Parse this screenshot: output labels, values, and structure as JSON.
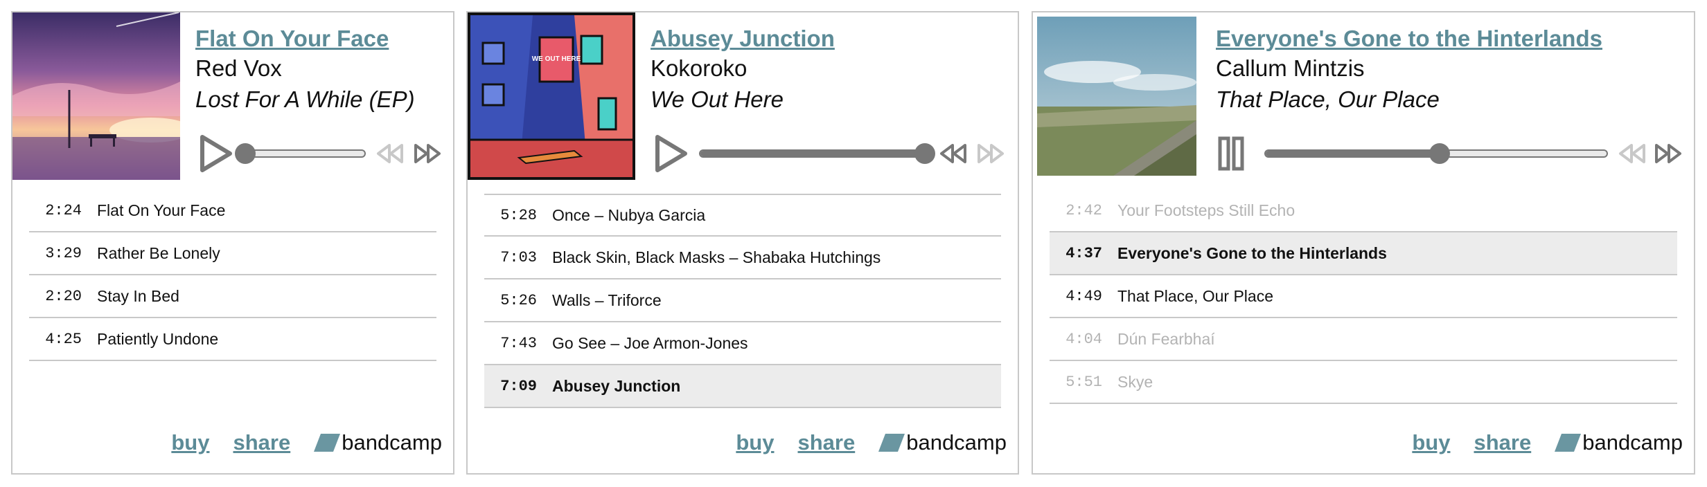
{
  "players": [
    {
      "title": "Flat On Your Face",
      "artist": "Red Vox",
      "album": "Lost For A While (EP)",
      "state": "paused",
      "progress": 0.0,
      "tracks": [
        {
          "time": "2:24",
          "name": "Flat On Your Face"
        },
        {
          "time": "3:29",
          "name": "Rather Be Lonely"
        },
        {
          "time": "2:20",
          "name": "Stay In Bed"
        },
        {
          "time": "4:25",
          "name": "Patiently Undone"
        }
      ],
      "footer": {
        "buy": "buy",
        "share": "share",
        "brand": "bandcamp"
      }
    },
    {
      "title": "Abusey Junction",
      "artist": "Kokoroko",
      "album": "We Out Here",
      "state": "paused",
      "progress": 1.0,
      "art_text": "WE OUT HERE",
      "tracks": [
        {
          "time": "5:28",
          "name": "Once – Nubya Garcia"
        },
        {
          "time": "7:03",
          "name": "Black Skin, Black Masks – Shabaka Hutchings"
        },
        {
          "time": "5:26",
          "name": "Walls – Triforce"
        },
        {
          "time": "7:43",
          "name": "Go See – Joe Armon-Jones"
        },
        {
          "time": "7:09",
          "name": "Abusey Junction",
          "current": true
        }
      ],
      "footer": {
        "buy": "buy",
        "share": "share",
        "brand": "bandcamp"
      }
    },
    {
      "title": "Everyone's Gone to the Hinterlands",
      "artist": "Callum Mintzis",
      "album": "That Place, Our Place",
      "state": "playing",
      "progress": 0.5,
      "tracks": [
        {
          "time": "2:42",
          "name": "Your Footsteps Still Echo",
          "dim": true
        },
        {
          "time": "4:37",
          "name": "Everyone's Gone to the Hinterlands",
          "current": true
        },
        {
          "time": "4:49",
          "name": "That Place, Our Place"
        },
        {
          "time": "4:04",
          "name": "Dún Fearbhaí",
          "dim": true
        },
        {
          "time": "5:51",
          "name": "Skye",
          "dim": true
        }
      ],
      "footer": {
        "buy": "buy",
        "share": "share",
        "brand": "bandcamp"
      }
    }
  ],
  "colors": {
    "link": "#5c8b97",
    "control": "#777777",
    "control_disabled": "#c8c8c8",
    "current_row": "#ececec"
  }
}
